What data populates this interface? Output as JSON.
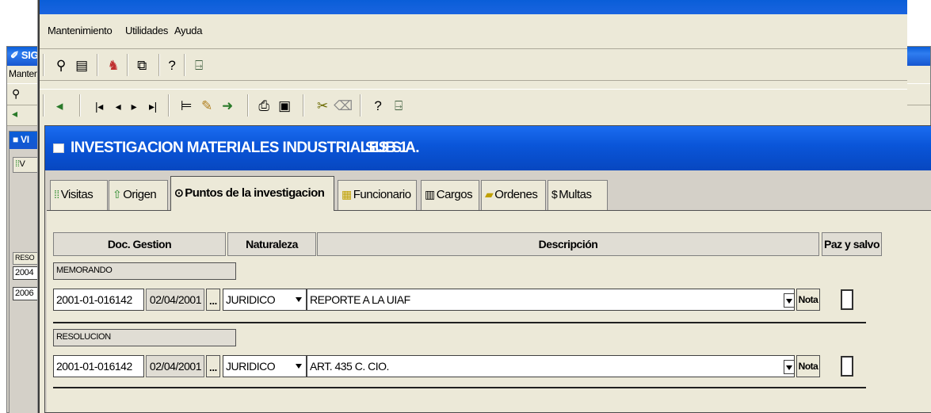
{
  "background_window": {
    "title": "SIG",
    "menu": "Manten",
    "inner_title": "VI",
    "inner_tab": "V",
    "column_header": "RESO",
    "rows": [
      "2004",
      "2006"
    ]
  },
  "menubar": {
    "items": [
      "Mantenimiento",
      "Utilidades",
      "Ayuda"
    ]
  },
  "toolbar1": {
    "icons": [
      "search-list-icon",
      "chess-knight-icon",
      "window-dropdown-icon",
      "help-icon",
      "exit-door-icon"
    ]
  },
  "toolbar2": {
    "icons": [
      "back-arrow-icon",
      "first-record-icon",
      "prev-record-icon",
      "next-record-icon",
      "last-record-icon",
      "tree-icon",
      "edit-pencil-icon",
      "go-icon",
      "print-icon",
      "save-icon",
      "cut-icon",
      "eraser-icon",
      "help-icon",
      "exit-door-icon"
    ]
  },
  "document": {
    "title": "INVESTIGACION MATERIALES INDUSTRIALES S.A.",
    "subtitle": "SUB 1",
    "tabs": [
      {
        "label": "Visitas",
        "icon": "grid-icon"
      },
      {
        "label": "Origen",
        "icon": "tree-up-icon"
      },
      {
        "label": "Puntos de la investigacion",
        "icon": "radio-icon",
        "active": true
      },
      {
        "label": "Funcionario",
        "icon": "person-card-icon"
      },
      {
        "label": "Cargos",
        "icon": "table-icon"
      },
      {
        "label": "Ordenes",
        "icon": "folder-icon"
      },
      {
        "label": "Multas",
        "icon": "dollar-icon"
      }
    ],
    "columns": [
      "Doc. Gestion",
      "Naturaleza",
      "Descripción",
      "Paz y salvo"
    ],
    "rows": [
      {
        "type": "MEMORANDO",
        "doc_number": "2001-01-016142",
        "date": "02/04/2001",
        "dots": "...",
        "naturaleza": "JURIDICO",
        "descripcion": "REPORTE A LA UIAF",
        "nota": "Nota",
        "paz_y_salvo": false
      },
      {
        "type": "RESOLUCION",
        "doc_number": "2001-01-016142",
        "date": "02/04/2001",
        "dots": "...",
        "naturaleza": "JURIDICO",
        "descripcion": "ART. 435 C. CIO.",
        "nota": "Nota",
        "paz_y_salvo": false
      }
    ]
  },
  "colors": {
    "title_blue": "#0a55d8",
    "window_face": "#ece9d8",
    "panel_gray": "#d4d0c8"
  }
}
